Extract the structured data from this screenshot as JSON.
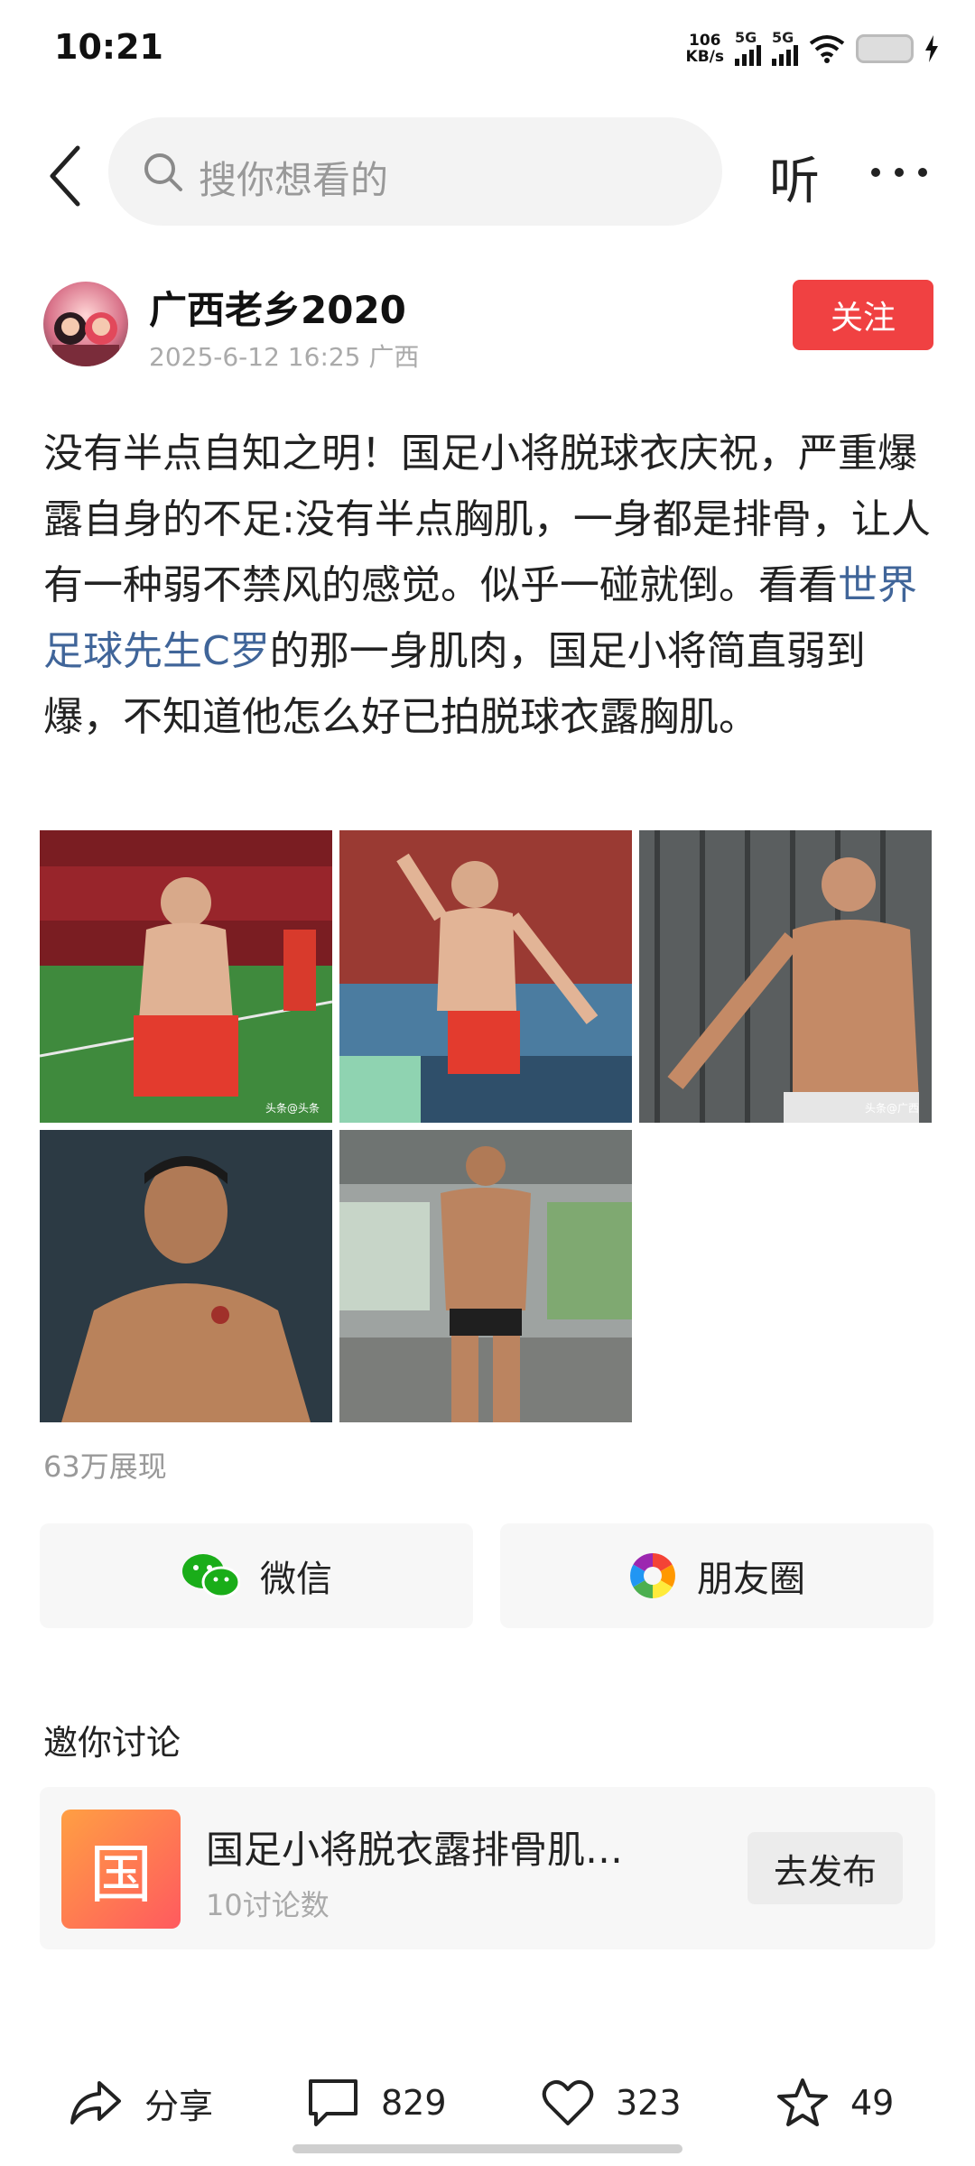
{
  "status": {
    "time": "10:21",
    "net_speed_value": "106",
    "net_speed_unit": "KB/s",
    "signal_1": "5G",
    "signal_2": "5G"
  },
  "search": {
    "placeholder": "搜你想看的"
  },
  "header": {
    "listen_label": "听"
  },
  "author": {
    "name": "广西老乡2020",
    "datetime": "2025-6-12 16:25",
    "location": "广西",
    "follow_label": "关注"
  },
  "post": {
    "text_before_link": "没有半点自知之明！国足小将脱球衣庆祝，严重爆露自身的不足:没有半点胸肌，一身都是排骨，让人有一种弱不禁风的感觉。似乎一碰就倒。看看",
    "link_text": "世界足球先生C罗",
    "text_after_link": "的那一身肌肉，国足小将简直弱到爆，不知道他怎么好已拍脱球衣露胸肌。",
    "photos": [
      {
        "name": "photo-player-celebration",
        "watermark": "头条@头条"
      },
      {
        "name": "photo-player-running",
        "watermark": ""
      },
      {
        "name": "photo-ronaldo-celebration",
        "watermark": "头条@广西"
      },
      {
        "name": "photo-ronaldo-portrait",
        "watermark": ""
      },
      {
        "name": "photo-ronaldo-gym",
        "watermark": ""
      }
    ],
    "views": "63万展现"
  },
  "share": {
    "wechat_label": "微信",
    "moments_label": "朋友圈"
  },
  "discussion": {
    "title": "邀你讨论",
    "topic_icon_char": "国",
    "topic_title": "国足小将脱衣露排骨肌…",
    "topic_count": "10讨论数",
    "publish_label": "去发布"
  },
  "actions": {
    "share_label": "分享",
    "comments": "829",
    "likes": "323",
    "favorites": "49"
  },
  "colors": {
    "follow": "#f04142",
    "link": "#406599",
    "wechat": "#1aad19"
  }
}
